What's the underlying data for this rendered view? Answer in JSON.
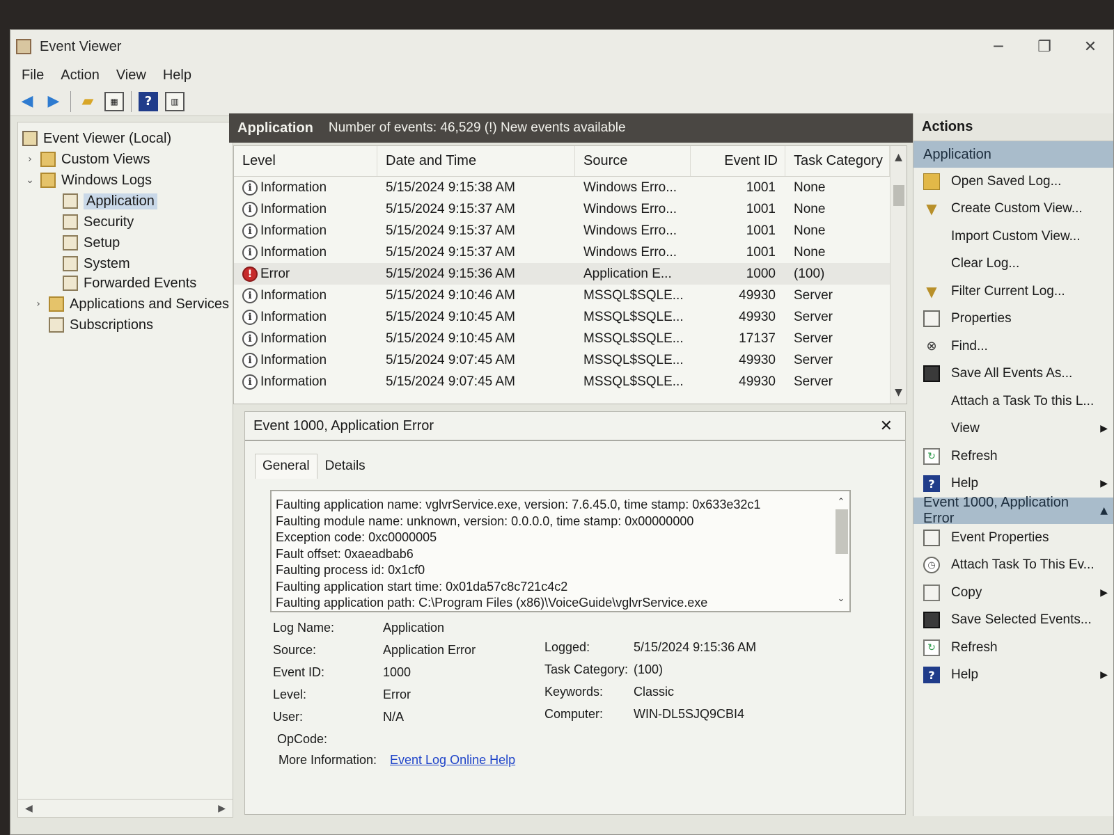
{
  "window": {
    "title": "Event Viewer",
    "controls": {
      "minimize": "─",
      "restore": "❐",
      "close": "✕"
    }
  },
  "menu": [
    "File",
    "Action",
    "View",
    "Help"
  ],
  "toolbar": [
    {
      "name": "back-arrow-icon",
      "glyph": "◀"
    },
    {
      "name": "forward-arrow-icon",
      "glyph": "▶"
    },
    {
      "name": "open-folder-icon",
      "glyph": "▰"
    },
    {
      "name": "show-hide-tree-icon",
      "glyph": "▦"
    },
    {
      "name": "help-icon",
      "glyph": "?"
    },
    {
      "name": "show-hide-action-pane-icon",
      "glyph": "▥"
    }
  ],
  "tree": {
    "root": "Event Viewer (Local)",
    "custom_views": "Custom Views",
    "windows_logs": "Windows Logs",
    "logs": [
      "Application",
      "Security",
      "Setup",
      "System",
      "Forwarded Events"
    ],
    "apps_services": "Applications and Services Lo",
    "subscriptions": "Subscriptions"
  },
  "center_header": {
    "title": "Application",
    "summary": "Number of events: 46,529 (!) New events available"
  },
  "columns": [
    "Level",
    "Date and Time",
    "Source",
    "Event ID",
    "Task Category"
  ],
  "events": [
    {
      "level": "Information",
      "date": "5/15/2024 9:15:38 AM",
      "source": "Windows Erro...",
      "id": "1001",
      "task": "None"
    },
    {
      "level": "Information",
      "date": "5/15/2024 9:15:37 AM",
      "source": "Windows Erro...",
      "id": "1001",
      "task": "None"
    },
    {
      "level": "Information",
      "date": "5/15/2024 9:15:37 AM",
      "source": "Windows Erro...",
      "id": "1001",
      "task": "None"
    },
    {
      "level": "Information",
      "date": "5/15/2024 9:15:37 AM",
      "source": "Windows Erro...",
      "id": "1001",
      "task": "None"
    },
    {
      "level": "Error",
      "date": "5/15/2024 9:15:36 AM",
      "source": "Application E...",
      "id": "1000",
      "task": "(100)"
    },
    {
      "level": "Information",
      "date": "5/15/2024 9:10:46 AM",
      "source": "MSSQL$SQLE...",
      "id": "49930",
      "task": "Server"
    },
    {
      "level": "Information",
      "date": "5/15/2024 9:10:45 AM",
      "source": "MSSQL$SQLE...",
      "id": "49930",
      "task": "Server"
    },
    {
      "level": "Information",
      "date": "5/15/2024 9:10:45 AM",
      "source": "MSSQL$SQLE...",
      "id": "17137",
      "task": "Server"
    },
    {
      "level": "Information",
      "date": "5/15/2024 9:07:45 AM",
      "source": "MSSQL$SQLE...",
      "id": "49930",
      "task": "Server"
    },
    {
      "level": "Information",
      "date": "5/15/2024 9:07:45 AM",
      "source": "MSSQL$SQLE...",
      "id": "49930",
      "task": "Server"
    }
  ],
  "detail": {
    "title": "Event 1000, Application Error",
    "close": "✕",
    "tabs": [
      "General",
      "Details"
    ],
    "description": [
      "Faulting application name: vglvrService.exe, version: 7.6.45.0, time stamp: 0x633e32c1",
      "Faulting module name: unknown, version: 0.0.0.0, time stamp: 0x00000000",
      "Exception code: 0xc0000005",
      "Fault offset: 0xaeadbab6",
      "Faulting process id: 0x1cf0",
      "Faulting application start time: 0x01da57c8c721c4c2",
      "Faulting application path: C:\\Program Files (x86)\\VoiceGuide\\vglvrService.exe"
    ],
    "props": {
      "log_name_label": "Log Name:",
      "log_name": "Application",
      "source_label": "Source:",
      "source": "Application Error",
      "logged_label": "Logged:",
      "logged": "5/15/2024 9:15:36 AM",
      "event_id_label": "Event ID:",
      "event_id": "1000",
      "task_label": "Task Category:",
      "task": "(100)",
      "level_label": "Level:",
      "level": "Error",
      "keywords_label": "Keywords:",
      "keywords": "Classic",
      "user_label": "User:",
      "user": "N/A",
      "computer_label": "Computer:",
      "computer": "WIN-DL5SJQ9CBI4",
      "opcode_label": "OpCode:",
      "more_info_label": "More Information:",
      "more_info_link": "Event Log Online Help"
    }
  },
  "actions": {
    "header": "Actions",
    "section1": "Application",
    "items1": [
      {
        "label": "Open Saved Log...",
        "icon": "folder",
        "name": "open-saved-log"
      },
      {
        "label": "Create Custom View...",
        "icon": "funnel",
        "name": "create-custom-view"
      },
      {
        "label": "Import Custom View...",
        "icon": "none",
        "name": "import-custom-view"
      },
      {
        "label": "Clear Log...",
        "icon": "none",
        "name": "clear-log"
      },
      {
        "label": "Filter Current Log...",
        "icon": "funnel",
        "name": "filter-current-log"
      },
      {
        "label": "Properties",
        "icon": "doc",
        "name": "properties"
      },
      {
        "label": "Find...",
        "icon": "bino",
        "name": "find"
      },
      {
        "label": "Save All Events As...",
        "icon": "save",
        "name": "save-all-events"
      },
      {
        "label": "Attach a Task To this L...",
        "icon": "none",
        "name": "attach-task-log"
      },
      {
        "label": "View",
        "icon": "none",
        "name": "view",
        "submenu": true
      },
      {
        "label": "Refresh",
        "icon": "refresh",
        "name": "refresh"
      },
      {
        "label": "Help",
        "icon": "help",
        "name": "help",
        "submenu": true
      }
    ],
    "section2": "Event 1000, Application Error",
    "items2": [
      {
        "label": "Event Properties",
        "icon": "doc",
        "name": "event-properties"
      },
      {
        "label": "Attach Task To This Ev...",
        "icon": "clock",
        "name": "attach-task-event"
      },
      {
        "label": "Copy",
        "icon": "copy",
        "name": "copy",
        "submenu": true
      },
      {
        "label": "Save Selected Events...",
        "icon": "save",
        "name": "save-selected-events"
      },
      {
        "label": "Refresh",
        "icon": "refresh",
        "name": "refresh-event"
      },
      {
        "label": "Help",
        "icon": "help",
        "name": "help-event",
        "submenu": true
      }
    ]
  }
}
